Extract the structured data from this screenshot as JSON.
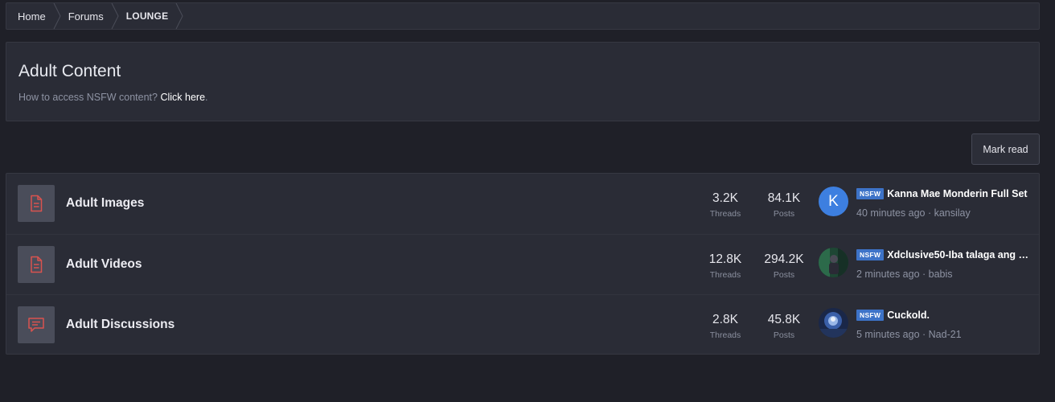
{
  "breadcrumb": {
    "items": [
      "Home",
      "Forums",
      "LOUNGE"
    ]
  },
  "header": {
    "title": "Adult Content",
    "description_prefix": "How to access NSFW content?",
    "description_link": "Click here",
    "description_suffix": "."
  },
  "toolbar": {
    "mark_read_label": "Mark read"
  },
  "forums": [
    {
      "title": "Adult Images",
      "icon": "document-icon",
      "threads": "3.2K",
      "threads_label": "Threads",
      "posts": "84.1K",
      "posts_label": "Posts",
      "latest": {
        "prefix": "NSFW",
        "title": "Kanna Mae Monderin Full Set",
        "time": "40 minutes ago",
        "user": "kansilay",
        "avatar_letter": "K"
      }
    },
    {
      "title": "Adult Videos",
      "icon": "document-icon",
      "threads": "12.8K",
      "threads_label": "Threads",
      "posts": "294.2K",
      "posts_label": "Posts",
      "latest": {
        "prefix": "NSFW",
        "title": "Xdclusive50-Iba talaga ang …",
        "time": "2 minutes ago",
        "user": "babis"
      }
    },
    {
      "title": "Adult Discussions",
      "icon": "chat-icon",
      "threads": "2.8K",
      "threads_label": "Threads",
      "posts": "45.8K",
      "posts_label": "Posts",
      "latest": {
        "prefix": "NSFW",
        "title": "Cuckold.",
        "time": "5 minutes ago",
        "user": "Nad-21"
      }
    }
  ],
  "colors": {
    "page_bg": "#1f2028",
    "panel_bg": "#2a2c36",
    "icon_accent": "#d9534f",
    "nsfw_badge": "#3d73c8",
    "avatar_blue": "#3d7fe0"
  }
}
